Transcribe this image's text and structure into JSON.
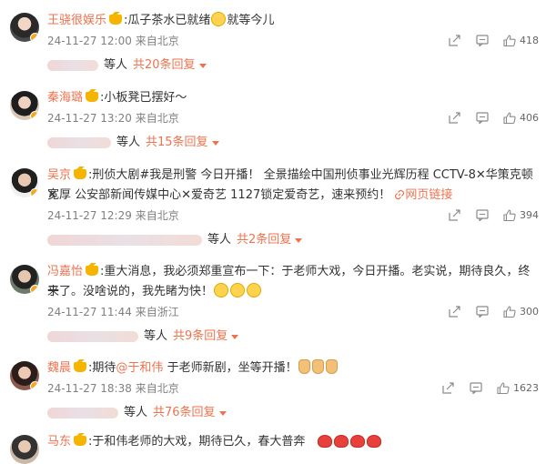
{
  "comments": [
    {
      "user": "王骁很娱乐",
      "sep": ":",
      "text_a": "瓜子茶水已就绪",
      "text_b": "就等今儿",
      "time": "24-11-27 12:00",
      "location": "来自北京",
      "likes": "418",
      "replies_prefix": "等人",
      "replies_total": "共20条回复"
    },
    {
      "user": "秦海璐",
      "sep": ":",
      "text_a": "小板凳已摆好～",
      "time": "24-11-27 13:20",
      "location": "来自北京",
      "likes": "406",
      "replies_prefix": "等人",
      "replies_total": "共15条回复"
    },
    {
      "user": "吴京",
      "sep": ":",
      "text_a": "刑侦大剧#我是刑警 今日开播！ 全景描绘中国刑侦事业光辉历程 CCTV-8✕华策克顿✕",
      "text_b": "宽厚 公安部新闻传媒中心✕爱奇艺 1127锁定爱奇艺，速来预约！",
      "link": "网页链接",
      "time": "24-11-27 12:29",
      "location": "来自北京",
      "likes": "394",
      "replies_prefix": "等人",
      "replies_total": "共2条回复"
    },
    {
      "user": "冯嘉怡",
      "sep": ":",
      "text_a": "重大消息，我必须郑重宣布一下：于老师大戏，今日开播。老实说，期待良久，终于",
      "text_b": "来了。没啥说的，我先睹为快！",
      "time": "24-11-27 11:44",
      "location": "来自浙江",
      "likes": "300",
      "replies_prefix": "等人",
      "replies_total": "共9条回复"
    },
    {
      "user": "魏晨",
      "sep": ":",
      "text_a": "期待",
      "mention": "@于和伟",
      "text_b": " 于老师新剧，坐等开播！",
      "time": "24-11-27 18:38",
      "location": "来自北京",
      "likes": "1623",
      "replies_prefix": "等人",
      "replies_total": "共76条回复"
    },
    {
      "user": "马东",
      "sep": ":",
      "text_a": "于和伟老师的大戏，期待已久，春大普奔"
    }
  ],
  "icons": {
    "share": "share-icon",
    "comment": "comment-icon",
    "like": "like-icon",
    "link": "link-icon"
  },
  "colors": {
    "accent": "#eb7350",
    "meta": "#808080",
    "text": "#333333"
  }
}
